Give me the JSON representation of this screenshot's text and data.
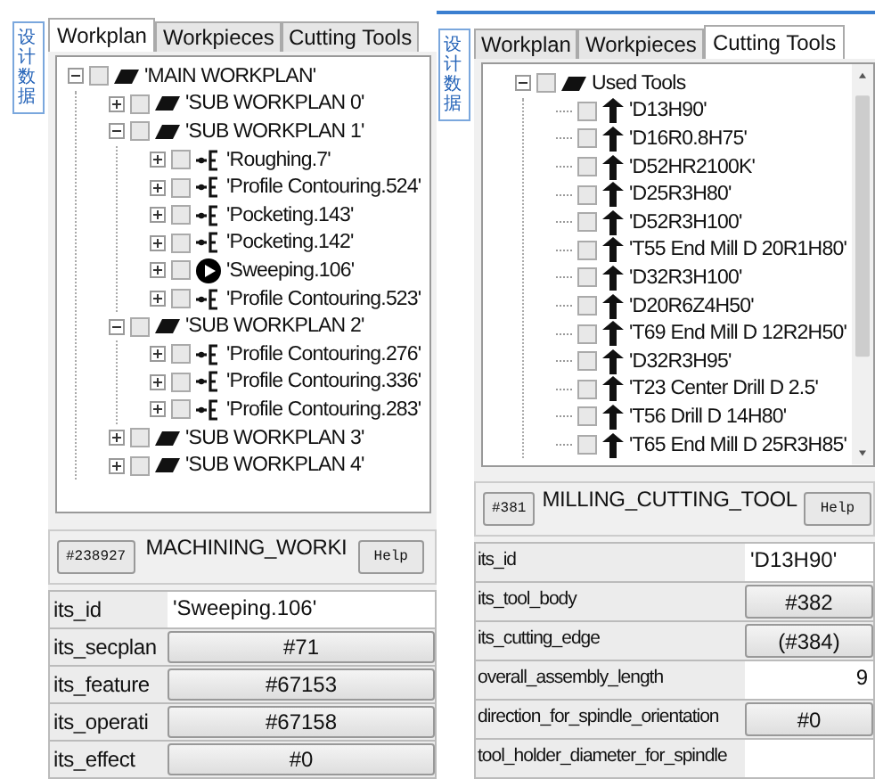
{
  "workplan_panel": {
    "side_tab": "设计数据",
    "tabs": [
      {
        "label": "Workplan",
        "selected": true
      },
      {
        "label": "Workpieces",
        "selected": false
      },
      {
        "label": "Cutting Tools",
        "selected": false
      }
    ],
    "tree": {
      "label": "'MAIN WORKPLAN'",
      "kind": "workplan",
      "checked": false,
      "expanded": true,
      "children": [
        {
          "label": "'SUB WORKPLAN 0'",
          "kind": "workplan",
          "checked": false,
          "expanded": false
        },
        {
          "label": "'SUB WORKPLAN 1'",
          "kind": "workplan",
          "checked": false,
          "expanded": true,
          "children": [
            {
              "label": "'Roughing.7'",
              "kind": "operation",
              "checked": false,
              "expanded": false
            },
            {
              "label": "'Profile Contouring.524'",
              "kind": "operation",
              "checked": false,
              "expanded": false
            },
            {
              "label": "'Pocketing.143'",
              "kind": "operation",
              "checked": false,
              "expanded": false
            },
            {
              "label": "'Pocketing.142'",
              "kind": "operation",
              "checked": false,
              "expanded": false
            },
            {
              "label": "'Sweeping.106'",
              "kind": "current",
              "checked": false,
              "expanded": false
            },
            {
              "label": "'Profile Contouring.523'",
              "kind": "operation",
              "checked": false,
              "expanded": false
            }
          ]
        },
        {
          "label": "'SUB WORKPLAN 2'",
          "kind": "workplan",
          "checked": false,
          "expanded": true,
          "children": [
            {
              "label": "'Profile Contouring.276'",
              "kind": "operation",
              "checked": false,
              "expanded": false
            },
            {
              "label": "'Profile Contouring.336'",
              "kind": "operation",
              "checked": false,
              "expanded": false
            },
            {
              "label": "'Profile Contouring.283'",
              "kind": "operation",
              "checked": false,
              "expanded": false
            }
          ]
        },
        {
          "label": "'SUB WORKPLAN 3'",
          "kind": "workplan",
          "checked": false,
          "expanded": false
        },
        {
          "label": "'SUB WORKPLAN 4'",
          "kind": "workplan",
          "checked": false,
          "expanded": false
        }
      ]
    },
    "header": {
      "id_button": "#238927",
      "title": "MACHINING_WORKI",
      "help_button": "Help"
    },
    "properties": [
      {
        "label": "its_id",
        "kind": "text",
        "value": "'Sweeping.106'"
      },
      {
        "label": "its_secplan",
        "kind": "button",
        "value": "#71"
      },
      {
        "label": "its_feature",
        "kind": "button",
        "value": "#67153"
      },
      {
        "label": "its_operati",
        "kind": "button",
        "value": "#67158"
      },
      {
        "label": "its_effect",
        "kind": "button",
        "value": "#0"
      }
    ]
  },
  "tools_panel": {
    "side_tab": "设计数据",
    "tabs": [
      {
        "label": "Workplan",
        "selected": false
      },
      {
        "label": "Workpieces",
        "selected": false
      },
      {
        "label": "Cutting Tools",
        "selected": true
      }
    ],
    "tree": {
      "label": "Used Tools",
      "kind": "workplan",
      "checked": false,
      "expanded": true,
      "children": [
        {
          "label": "'D13H90'",
          "kind": "tool",
          "checked": false
        },
        {
          "label": "'D16R0.8H75'",
          "kind": "tool",
          "checked": false
        },
        {
          "label": "'D52HR2100K'",
          "kind": "tool",
          "checked": false
        },
        {
          "label": "'D25R3H80'",
          "kind": "tool",
          "checked": false
        },
        {
          "label": "'D52R3H100'",
          "kind": "tool",
          "checked": false
        },
        {
          "label": "'T55 End Mill D 20R1H80'",
          "kind": "tool",
          "checked": false
        },
        {
          "label": "'D32R3H100'",
          "kind": "tool",
          "checked": false
        },
        {
          "label": "'D20R6Z4H50'",
          "kind": "tool",
          "checked": false
        },
        {
          "label": "'T69 End Mill D 12R2H50'",
          "kind": "tool",
          "checked": false
        },
        {
          "label": "'D32R3H95'",
          "kind": "tool",
          "checked": false
        },
        {
          "label": "'T23 Center Drill D 2.5'",
          "kind": "tool",
          "checked": false
        },
        {
          "label": "'T56 Drill D 14H80'",
          "kind": "tool",
          "checked": false
        },
        {
          "label": "'T65 End Mill D 25R3H85'",
          "kind": "tool",
          "checked": false
        }
      ]
    },
    "header": {
      "id_button": "#381",
      "title": "MILLING_CUTTING_TOOL",
      "help_button": "Help"
    },
    "properties": [
      {
        "label": "its_id",
        "kind": "text",
        "value": "'D13H90'"
      },
      {
        "label": "its_tool_body",
        "kind": "button",
        "value": "#382"
      },
      {
        "label": "its_cutting_edge",
        "kind": "button",
        "value": "(#384)"
      },
      {
        "label": "overall_assembly_length",
        "kind": "number",
        "value": "9"
      },
      {
        "label": "direction_for_spindle_orientation",
        "kind": "button",
        "value": "#0"
      },
      {
        "label": "tool_holder_diameter_for_spindle",
        "kind": "number"
      }
    ]
  }
}
